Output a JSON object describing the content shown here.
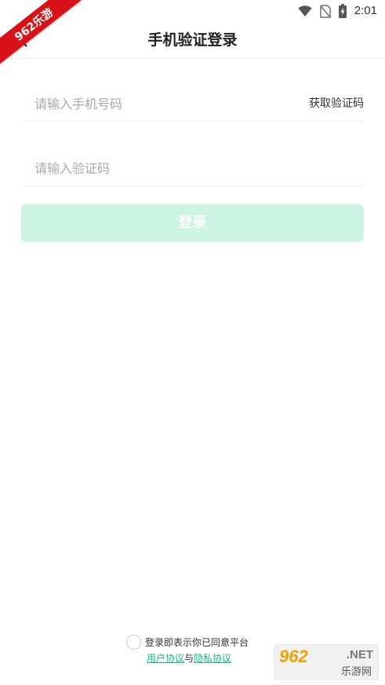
{
  "status_bar": {
    "time": "2:01",
    "icons": [
      "wifi-icon",
      "no-sim-icon",
      "battery-charging-icon"
    ]
  },
  "watermark_ribbon": "962乐游",
  "header": {
    "back_icon": "chevron-left-icon",
    "title": "手机验证登录"
  },
  "form": {
    "phone_placeholder": "请输入手机号码",
    "phone_value": "",
    "get_code_label": "获取验证码",
    "code_placeholder": "请输入验证码",
    "code_value": "",
    "login_label": "登录"
  },
  "agreement": {
    "checked": false,
    "text": "登录即表示你已同意平台",
    "user_agreement": "用户协议",
    "connector": "与",
    "privacy_agreement": "隐私协议"
  },
  "watermark": {
    "main": "962",
    "suffix": ".NET",
    "sub": "乐游网"
  },
  "colors": {
    "accent": "#1aba86",
    "button_disabled_bg": "#ccf3e4",
    "ribbon": "#d9121a"
  }
}
